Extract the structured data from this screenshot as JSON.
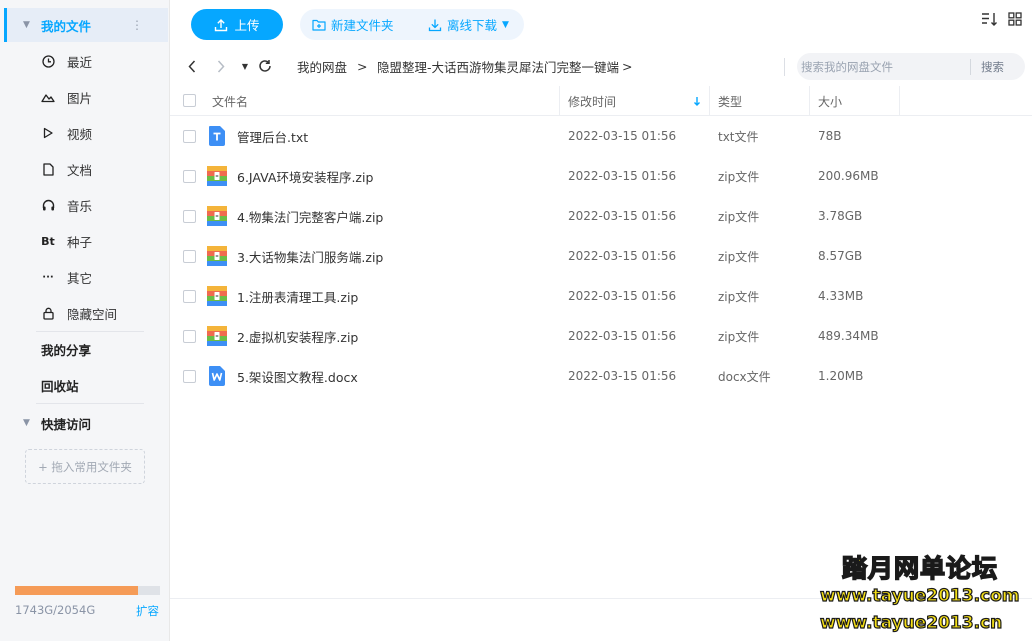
{
  "sidebar": {
    "my_files": "我的文件",
    "items": [
      {
        "label": "最近",
        "icon": "clock-icon"
      },
      {
        "label": "图片",
        "icon": "image-icon"
      },
      {
        "label": "视频",
        "icon": "video-icon"
      },
      {
        "label": "文档",
        "icon": "document-icon"
      },
      {
        "label": "音乐",
        "icon": "headphones-icon"
      },
      {
        "label": "种子",
        "icon": "torrent-icon",
        "glyph": "Bt"
      },
      {
        "label": "其它",
        "icon": "more-icon",
        "glyph": "···"
      },
      {
        "label": "隐藏空间",
        "icon": "lock-icon"
      }
    ],
    "my_share": "我的分享",
    "recycle": "回收站",
    "quick_access": "快捷访问",
    "drag_hint": "+ 拖入常用文件夹",
    "quota_text": "1743G/2054G",
    "quota_used_fraction": 0.849,
    "expand": "扩容"
  },
  "toolbar": {
    "upload": "上传",
    "new_folder": "新建文件夹",
    "offline_download": "离线下载"
  },
  "breadcrumb": {
    "root": "我的网盘",
    "folder": "隐盟整理-大话西游物集灵犀法门完整一键端",
    "sep": ">"
  },
  "search": {
    "placeholder": "搜索我的网盘文件",
    "button": "搜索"
  },
  "table": {
    "headers": {
      "name": "文件名",
      "modified": "修改时间",
      "type": "类型",
      "size": "大小"
    },
    "rows": [
      {
        "name": "管理后台.txt",
        "modified": "2022-03-15 01:56",
        "type": "txt文件",
        "size": "78B",
        "icon": "txt"
      },
      {
        "name": "6.JAVA环境安装程序.zip",
        "modified": "2022-03-15 01:56",
        "type": "zip文件",
        "size": "200.96MB",
        "icon": "zip"
      },
      {
        "name": "4.物集法门完整客户端.zip",
        "modified": "2022-03-15 01:56",
        "type": "zip文件",
        "size": "3.78GB",
        "icon": "zip"
      },
      {
        "name": "3.大话物集法门服务端.zip",
        "modified": "2022-03-15 01:56",
        "type": "zip文件",
        "size": "8.57GB",
        "icon": "zip"
      },
      {
        "name": "1.注册表清理工具.zip",
        "modified": "2022-03-15 01:56",
        "type": "zip文件",
        "size": "4.33MB",
        "icon": "zip"
      },
      {
        "name": "2.虚拟机安装程序.zip",
        "modified": "2022-03-15 01:56",
        "type": "zip文件",
        "size": "489.34MB",
        "icon": "zip"
      },
      {
        "name": "5.架设图文教程.docx",
        "modified": "2022-03-15 01:56",
        "type": "docx文件",
        "size": "1.20MB",
        "icon": "docx"
      }
    ]
  },
  "watermark": {
    "title": "踏月网单论坛",
    "url1": "www.tayue2013.com",
    "url2": "www.tayue2013.cn"
  },
  "colors": {
    "accent": "#06a7ff",
    "quota_fill": "#f59b57",
    "active_bg": "#e6edf7"
  }
}
